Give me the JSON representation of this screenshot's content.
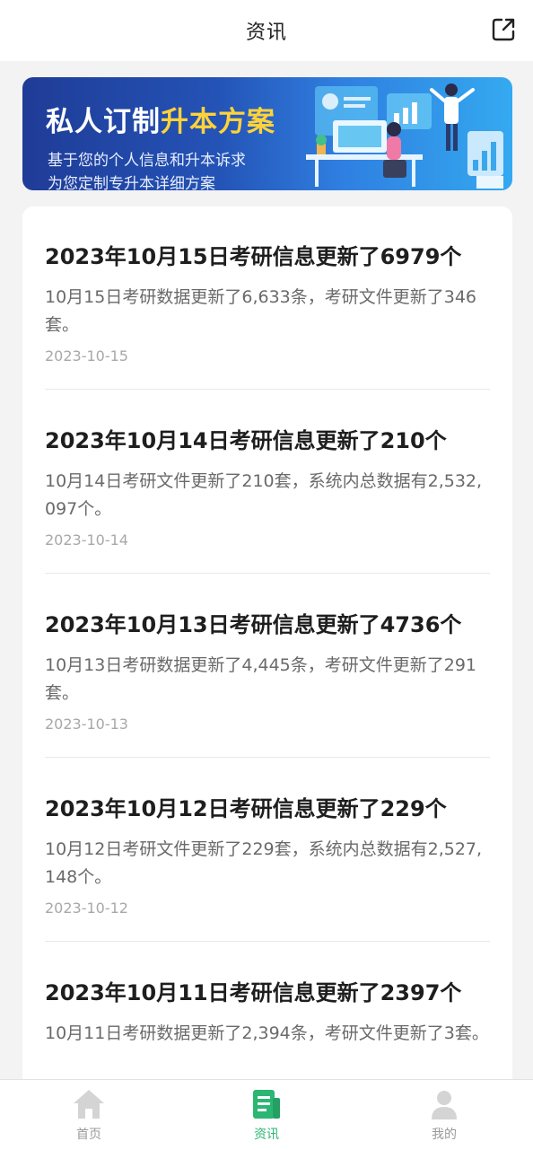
{
  "header": {
    "title": "资讯"
  },
  "banner": {
    "title_plain": "私人订制",
    "title_highlight": "升本方案",
    "line1": "基于您的个人信息和升本诉求",
    "line2": "为您定制专升本详细方案"
  },
  "news": [
    {
      "title": "2023年10月15日考研信息更新了6979个",
      "summary": "10月15日考研数据更新了6,633条，考研文件更新了346套。",
      "date": "2023-10-15"
    },
    {
      "title": "2023年10月14日考研信息更新了210个",
      "summary": "10月14日考研文件更新了210套，系统内总数据有2,532,097个。",
      "date": "2023-10-14"
    },
    {
      "title": "2023年10月13日考研信息更新了4736个",
      "summary": "10月13日考研数据更新了4,445条，考研文件更新了291套。",
      "date": "2023-10-13"
    },
    {
      "title": "2023年10月12日考研信息更新了229个",
      "summary": "10月12日考研文件更新了229套，系统内总数据有2,527,148个。",
      "date": "2023-10-12"
    },
    {
      "title": "2023年10月11日考研信息更新了2397个",
      "summary": "10月11日考研数据更新了2,394条，考研文件更新了3套。",
      "date": ""
    }
  ],
  "tabbar": {
    "items": [
      {
        "label": "首页",
        "icon": "home-icon",
        "active": false
      },
      {
        "label": "资讯",
        "icon": "news-icon",
        "active": true
      },
      {
        "label": "我的",
        "icon": "user-icon",
        "active": false
      }
    ],
    "active_color": "#2bb673",
    "inactive_color": "#d0d0d0"
  }
}
